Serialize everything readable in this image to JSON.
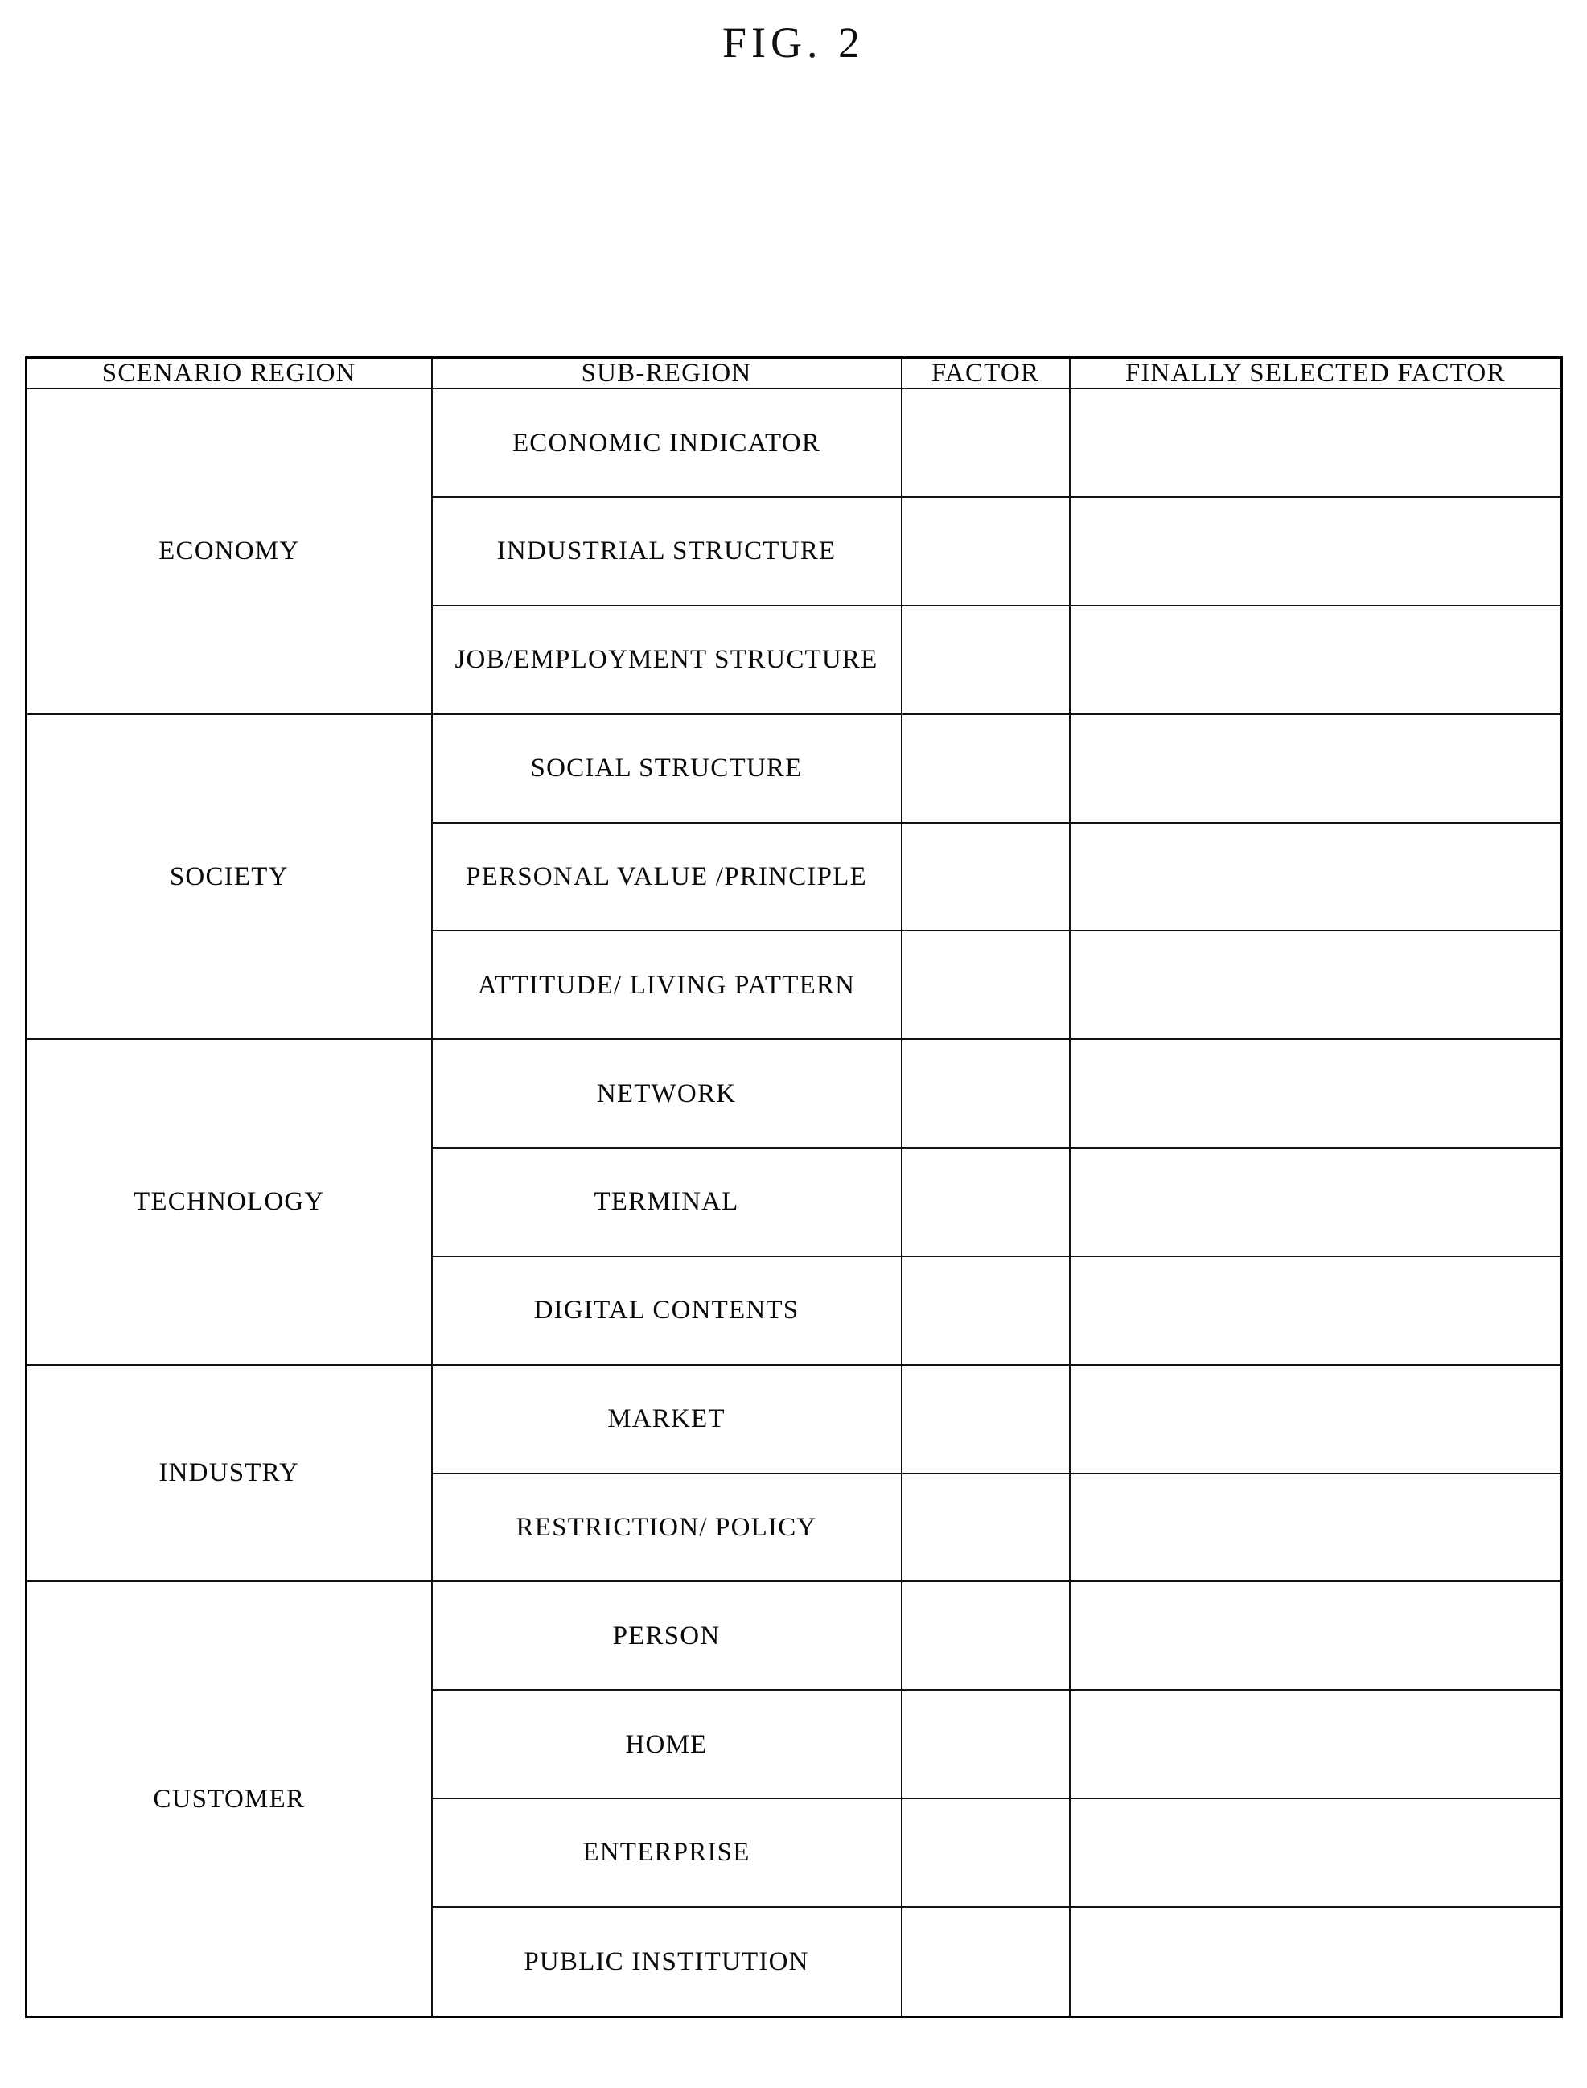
{
  "figure": {
    "title": "FIG. 2"
  },
  "table": {
    "headers": [
      "SCENARIO REGION",
      "SUB-REGION",
      "FACTOR",
      "FINALLY SELECTED FACTOR"
    ],
    "groups": [
      {
        "region": "ECONOMY",
        "subregions": [
          "ECONOMIC INDICATOR",
          "INDUSTRIAL STRUCTURE",
          "JOB/EMPLOYMENT STRUCTURE"
        ]
      },
      {
        "region": "SOCIETY",
        "subregions": [
          "SOCIAL STRUCTURE",
          "PERSONAL VALUE /PRINCIPLE",
          "ATTITUDE/ LIVING PATTERN"
        ]
      },
      {
        "region": "TECHNOLOGY",
        "subregions": [
          "NETWORK",
          "TERMINAL",
          "DIGITAL CONTENTS"
        ]
      },
      {
        "region": "INDUSTRY",
        "subregions": [
          "MARKET",
          "RESTRICTION/ POLICY"
        ]
      },
      {
        "region": "CUSTOMER",
        "subregions": [
          "PERSON",
          "HOME",
          "ENTERPRISE",
          "PUBLIC INSTITUTION"
        ]
      }
    ],
    "factor_values": [
      "",
      "",
      "",
      "",
      "",
      "",
      "",
      "",
      "",
      "",
      "",
      "",
      "",
      "",
      ""
    ],
    "finally_selected_factor_values": [
      "",
      "",
      "",
      "",
      "",
      "",
      "",
      "",
      "",
      "",
      "",
      "",
      "",
      "",
      ""
    ]
  },
  "style": {
    "line_color": "#111111",
    "text_color": "#0a0a0a",
    "background": "#ffffff"
  }
}
